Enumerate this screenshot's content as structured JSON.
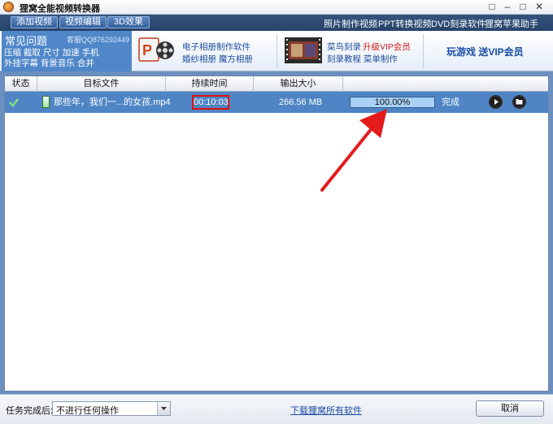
{
  "window": {
    "title": "狸窝全能视频转换器",
    "controls": [
      "□",
      "–",
      "□",
      "✕"
    ]
  },
  "toolbar": {
    "add_video": "添加视频",
    "edit_video": "视频编辑",
    "effect_3d": "3D效果",
    "links": [
      "照片制作视频",
      "PPT转换视频",
      "DVD刻录软件",
      "狸窝苹果助手"
    ]
  },
  "banner": {
    "faq_title": "常见问题",
    "faq_qq": "客服QQ876292449",
    "faq_line1": "压缩 截取 尺寸 加速 手机",
    "faq_line2": "外挂字幕 背景音乐 合并",
    "promo1_line1": "电子相册制作软件",
    "promo1_line2": "婚纱相册  魔方相册",
    "promo2_line1a": "菜鸟刻录",
    "promo2_line1b": "升级VIP会员",
    "promo2_line2": "刻录教程  菜单制作",
    "vip": "玩游戏  送VIP会员"
  },
  "table": {
    "headers": [
      "状态",
      "目标文件",
      "持续时间",
      "输出大小",
      ""
    ],
    "rows": [
      {
        "file": "那些年，我们一...的女孩.mp4",
        "duration": "00:10:03",
        "size": "266.56 MB",
        "progress_text": "100.00%",
        "progress": 1.0,
        "status": "完成"
      }
    ]
  },
  "statusbar": {
    "label": "任务完成后:",
    "select_value": "不进行任何操作",
    "download_link": "下载狸窝所有软件",
    "cancel": "取消"
  },
  "colors": {
    "row_selected": "#4f85c5",
    "highlight_box": "#e01010",
    "annotation_arrow": "#e31b1b"
  }
}
